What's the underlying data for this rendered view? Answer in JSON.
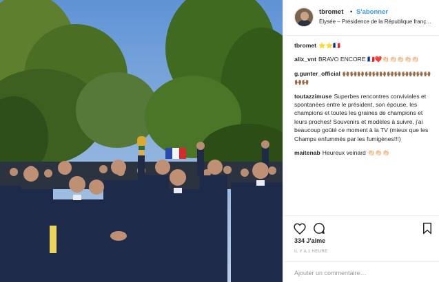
{
  "post": {
    "username": "tbromet",
    "separator": "•",
    "follow_label": "S'abonner",
    "location": "Élysée – Présidence de la République franç…"
  },
  "comments": [
    {
      "username": "tbromet",
      "text": "⭐⭐🇫🇷"
    },
    {
      "username": "alix_vnt",
      "text": "BRAVO ENCORE 🇫🇷❤️👏🏻👏🏻👏🏻👏🏻👏🏻"
    },
    {
      "username": "g.gunter_official",
      "text": "🙌🏾🙌🏾🙌🏾🙌🏾🙌🏾🙌🏾🙌🏾🙌🏾🙌🏾🙌🏾🙌🏾🙌🏾🙌🏾🙌🏾"
    },
    {
      "username": "toutazzimuse",
      "text": "Superbes rencontres conviviales et spontanées entre le président, son épouse, les champions et toutes les graines de champions et leurs proches! Souvenirs et modèles à suivre, j'ai beaucoup goûté ce moment à la TV (mieux que les Champs enfummés par les fumigènes!!!)"
    },
    {
      "username": "maitenab",
      "text": "Heureux veinard 👏🏻👏🏻👏🏻"
    }
  ],
  "stats": {
    "likes": "334 J'aime",
    "time": "IL Y A 1 HEURE"
  },
  "comment_box": {
    "placeholder": "Ajouter un commentaire…"
  },
  "icons": {
    "like": "heart-icon",
    "comment": "comment-bubble-icon",
    "save": "bookmark-icon"
  },
  "colors": {
    "link": "#3897f0",
    "text": "#262626",
    "muted": "#999999",
    "border": "#efefef"
  }
}
